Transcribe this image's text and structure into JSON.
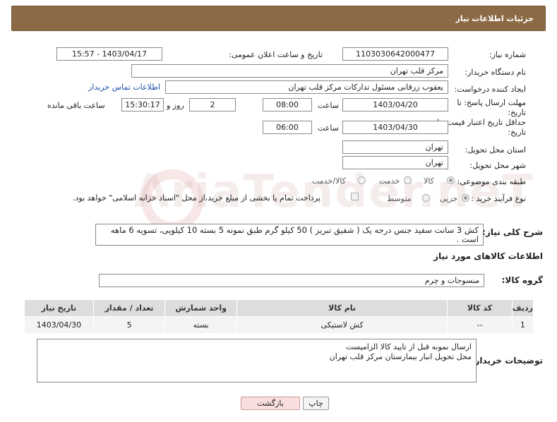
{
  "header": {
    "title": "جزئیات اطلاعات نیاز"
  },
  "form": {
    "need_number_label": "شماره نیاز:",
    "need_number": "1103030642000477",
    "announce_label": "تاریخ و ساعت اعلان عمومی:",
    "announce_value": "1403/04/17 - 15:57",
    "buyer_org_label": "نام دستگاه خریدار:",
    "buyer_org": "مرکز قلب تهران",
    "requester_label": "ایجاد کننده درخواست:",
    "requester": "یعقوب زرقانی مسئول تدارکات مرکز قلب تهران",
    "contact_link": "اطلاعات تماس خریدار",
    "deadline_label_1": "مهلت ارسال پاسخ: تا",
    "deadline_label_2": "تاریخ:",
    "deadline_date": "1403/04/20",
    "time_label": "ساعت",
    "deadline_time": "08:00",
    "days_value": "2",
    "days_label": "روز و",
    "remaining_time": "15:30:17",
    "remaining_label": "ساعت باقی مانده",
    "validity_label_1": "حداقل تاریخ اعتبار قیمت: تا",
    "validity_label_2": "تاریخ:",
    "validity_date": "1403/04/30",
    "validity_time": "06:00",
    "province_label": "استان محل تحویل:",
    "province": "تهران",
    "city_label": "شهر محل تحویل:",
    "city": "تهران",
    "category_label": "طبقه بندی موضوعی:",
    "category_options": [
      "کالا",
      "خدمت",
      "کالا/خدمت"
    ],
    "process_label": "نوع فرآیند خرید :",
    "process_options": [
      "جزیی",
      "متوسط"
    ],
    "payment_note": "پرداخت تمام یا بخشی از مبلغ خرید،از محل \"اسناد خزانه اسلامی\" خواهد بود.",
    "description_label": "شرح کلی نیاز:",
    "description": "کش 3 سانت سفید جنس درجه یک ( شفیق تبریز ) 50 کیلو گرم طبق نمونه 5 بسته 10 کیلویی، تسویه 6 ماهه است ."
  },
  "goods": {
    "section_title": "اطلاعات کالاهای مورد نیاز",
    "group_label": "گروه کالا:",
    "group_value": "منسوجات و چرم",
    "columns": [
      "ردیف",
      "کد کالا",
      "نام کالا",
      "واحد شمارش",
      "تعداد / مقدار",
      "تاریخ نیاز"
    ],
    "rows": [
      {
        "row": "1",
        "code": "--",
        "name": "کش لاستیکی",
        "unit": "بسته",
        "qty": "5",
        "date": "1403/04/30"
      }
    ]
  },
  "buyer_notes": {
    "label": "توضیحات خریدار:",
    "line1": "ارسال نمونه قبل از تایید کالا الزامیست",
    "line2": "محل تحویل انبار بیمارستان مرکز قلب تهران"
  },
  "buttons": {
    "print": "چاپ",
    "back": "بازگشت"
  },
  "watermark": {
    "text": "AriaTender.neT"
  }
}
